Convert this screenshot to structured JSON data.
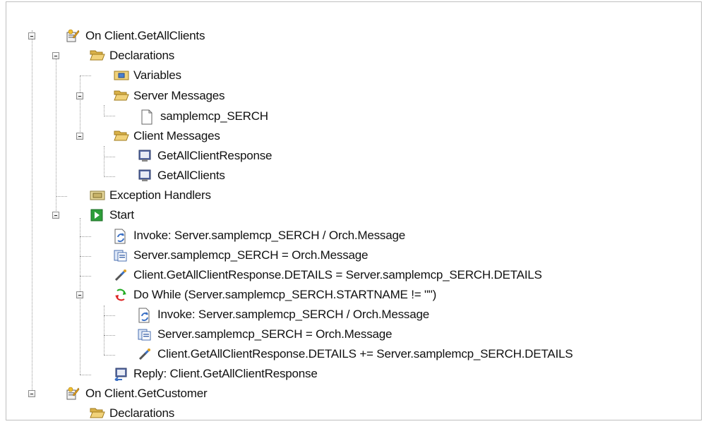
{
  "tree": {
    "nodes": [
      {
        "label": "On Client.GetAllClients",
        "icon": "orchestration-method-icon"
      },
      {
        "label": "Declarations",
        "icon": "open-folder-icon"
      },
      {
        "label": "Variables",
        "icon": "variables-folder-icon"
      },
      {
        "label": "Server Messages",
        "icon": "open-folder-icon"
      },
      {
        "label": "samplemcp_SERCH",
        "icon": "document-icon"
      },
      {
        "label": "Client Messages",
        "icon": "open-folder-icon"
      },
      {
        "label": "GetAllClientResponse",
        "icon": "message-monitor-icon"
      },
      {
        "label": "GetAllClients",
        "icon": "message-monitor-icon"
      },
      {
        "label": "Exception Handlers",
        "icon": "exception-handlers-folder-icon"
      },
      {
        "label": "Start",
        "icon": "start-play-icon"
      },
      {
        "label": "Invoke: Server.samplemcp_SERCH / Orch.Message",
        "icon": "invoke-icon"
      },
      {
        "label": "Server.samplemcp_SERCH = Orch.Message",
        "icon": "assign-message-icon"
      },
      {
        "label": "Client.GetAllClientResponse.DETAILS = Server.samplemcp_SERCH.DETAILS",
        "icon": "assign-wand-icon"
      },
      {
        "label": "Do While (Server.samplemcp_SERCH.STARTNAME != \"\")",
        "icon": "loop-icon"
      },
      {
        "label": "Invoke: Server.samplemcp_SERCH / Orch.Message",
        "icon": "invoke-icon"
      },
      {
        "label": "Server.samplemcp_SERCH = Orch.Message",
        "icon": "assign-message-icon"
      },
      {
        "label": "Client.GetAllClientResponse.DETAILS += Server.samplemcp_SERCH.DETAILS",
        "icon": "assign-wand-icon"
      },
      {
        "label": "Reply: Client.GetAllClientResponse",
        "icon": "reply-icon"
      },
      {
        "label": "On Client.GetCustomer",
        "icon": "orchestration-method-icon"
      },
      {
        "label": "Declarations",
        "icon": "open-folder-icon"
      }
    ]
  },
  "colors": {
    "folder": "#e8c770",
    "folder_dark": "#b88f2c",
    "start": "#2e9e3a",
    "invoke": "#3a6fc4",
    "loop_red": "#d22",
    "loop_green": "#2a2"
  }
}
